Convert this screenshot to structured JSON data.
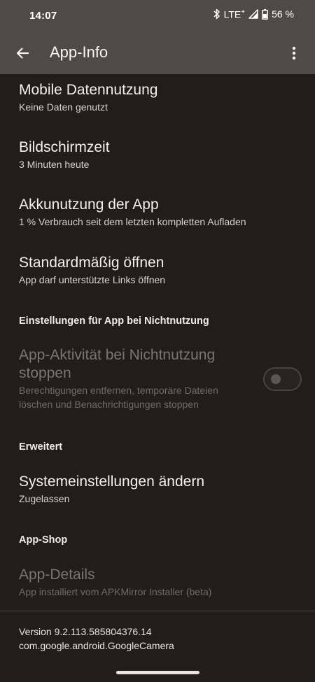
{
  "status_bar": {
    "time": "14:07",
    "network": "LTE",
    "battery": "56 %",
    "icons": [
      "bluetooth-icon",
      "lte-icon",
      "signal-icon",
      "battery-icon"
    ]
  },
  "app_bar": {
    "title": "App-Info",
    "back_icon": "arrow-back-icon",
    "more_icon": "more-vert-icon"
  },
  "items": {
    "mobile_data": {
      "title": "Mobile Datennutzung",
      "subtitle": "Keine Daten genutzt"
    },
    "screen_time": {
      "title": "Bildschirmzeit",
      "subtitle": "3 Minuten heute"
    },
    "battery": {
      "title": "Akkunutzung der App",
      "subtitle": "1 % Verbrauch seit dem letzten kompletten Aufladen"
    },
    "open_default": {
      "title": "Standardmäßig öffnen",
      "subtitle": "App darf unterstützte Links öffnen"
    },
    "pause_activity": {
      "title_line1": "App-Aktivität bei Nichtnutzung",
      "title_line2": "stoppen",
      "subtitle_line1": "Berechtigungen entfernen, temporäre Dateien",
      "subtitle_line2": "löschen und Benachrichtigungen stoppen",
      "enabled": false
    },
    "system_settings": {
      "title": "Systemeinstellungen ändern",
      "subtitle": "Zugelassen"
    },
    "app_details": {
      "title": "App-Details",
      "subtitle": "App installiert vom APKMirror Installer (beta)"
    }
  },
  "headers": {
    "unused": "Einstellungen für App bei Nichtnutzung",
    "advanced": "Erweitert",
    "store": "App-Shop"
  },
  "footer": {
    "version": "Version 9.2.113.585804376.14",
    "package": "com.google.android.GoogleCamera"
  },
  "colors": {
    "background": "#231c1c",
    "app_bar": "#514848",
    "text_primary": "#f4efef",
    "text_disabled": "#7c7373"
  }
}
